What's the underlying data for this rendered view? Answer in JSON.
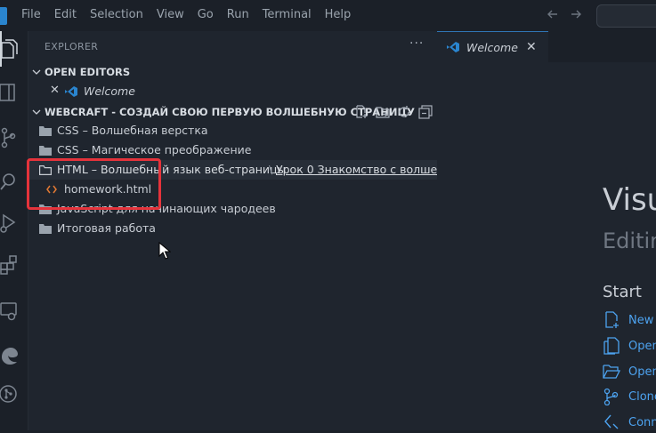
{
  "menubar": {
    "items": [
      "File",
      "Edit",
      "Selection",
      "View",
      "Go",
      "Run",
      "Terminal",
      "Help"
    ]
  },
  "activity_bar": {
    "icons": [
      "explorer-icon",
      "search-icon",
      "source-control-icon",
      "run-debug-icon",
      "extensions-icon",
      "remote-explorer-icon",
      "edge-devtools-icon",
      "git-graph-icon"
    ]
  },
  "sidebar": {
    "title": "EXPLORER",
    "more": "···",
    "open_editors": {
      "header": "OPEN EDITORS",
      "items": [
        {
          "label": "Welcome",
          "close": "✕"
        }
      ]
    },
    "workspace": {
      "header": "WEBCRAFT - СОЗДАЙ СВОЮ ПЕРВУЮ ВОЛШЕБНУЮ СТРАНИЦУ",
      "tree": [
        {
          "label": "CSS – Волшебная верстка"
        },
        {
          "label": "CSS – Магическое преображение"
        },
        {
          "label": "HTML – Волшебный язык веб-страницы",
          "separator": "\\",
          "path": "Урок 0 Знакомство с волше..."
        },
        {
          "label": "homework.html"
        },
        {
          "label": "JavaScript для начинающих чародеев"
        },
        {
          "label": "Итоговая работа"
        }
      ]
    }
  },
  "editor": {
    "tab": {
      "label": "Welcome",
      "close": "✕"
    },
    "welcome": {
      "title": "Visu",
      "subtitle": "Editin",
      "start_heading": "Start",
      "start_items": [
        "New",
        "Open",
        "Open",
        "Clone",
        "Conn"
      ]
    }
  },
  "colors": {
    "background": "#1b2028",
    "sidebar": "#1f252e",
    "accent_blue": "#2a85cf",
    "link": "#4da3f0",
    "highlight_red": "#e5333b",
    "html_icon": "#e37933"
  }
}
